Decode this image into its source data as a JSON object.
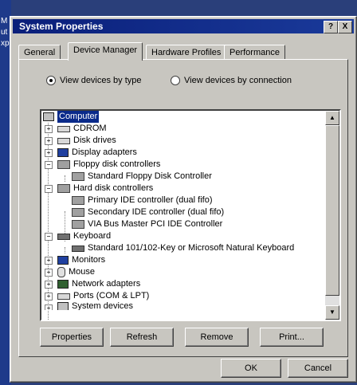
{
  "desktop": {
    "side_text": "M    ut    xp"
  },
  "window": {
    "title": "System Properties",
    "help_button": "?",
    "close_button": "X"
  },
  "tabs": [
    {
      "label": "General"
    },
    {
      "label": "Device Manager"
    },
    {
      "label": "Hardware Profiles"
    },
    {
      "label": "Performance"
    }
  ],
  "view_options": {
    "by_type": "View devices by type",
    "by_connection": "View devices by connection",
    "selected": "by_type"
  },
  "tree": {
    "root": "Computer",
    "items": [
      {
        "label": "CDROM",
        "expander": "+",
        "icon": "cdrom-icon"
      },
      {
        "label": "Disk drives",
        "expander": "+",
        "icon": "disk-drive-icon"
      },
      {
        "label": "Display adapters",
        "expander": "+",
        "icon": "display-adapter-icon"
      },
      {
        "label": "Floppy disk controllers",
        "expander": "−",
        "icon": "floppy-controller-icon"
      },
      {
        "label": "Standard Floppy Disk Controller",
        "icon": "floppy-controller-icon"
      },
      {
        "label": "Hard disk controllers",
        "expander": "−",
        "icon": "hard-disk-controller-icon"
      },
      {
        "label": "Primary IDE controller (dual fifo)",
        "icon": "ide-controller-icon"
      },
      {
        "label": "Secondary IDE controller (dual fifo)",
        "icon": "ide-controller-icon"
      },
      {
        "label": "VIA Bus Master PCI IDE Controller",
        "icon": "ide-controller-icon"
      },
      {
        "label": "Keyboard",
        "expander": "−",
        "icon": "keyboard-icon"
      },
      {
        "label": "Standard 101/102-Key or Microsoft Natural Keyboard",
        "icon": "keyboard-icon"
      },
      {
        "label": "Monitors",
        "expander": "+",
        "icon": "monitor-icon"
      },
      {
        "label": "Mouse",
        "expander": "+",
        "icon": "mouse-icon"
      },
      {
        "label": "Network adapters",
        "expander": "+",
        "icon": "network-adapter-icon"
      },
      {
        "label": "Ports (COM & LPT)",
        "expander": "+",
        "icon": "ports-icon"
      },
      {
        "label": "System devices",
        "expander": "+",
        "icon": "system-devices-icon"
      }
    ]
  },
  "buttons": {
    "properties": "Properties",
    "refresh": "Refresh",
    "remove": "Remove",
    "print": "Print...",
    "ok": "OK",
    "cancel": "Cancel"
  },
  "colors": {
    "title_bar": "#0a1f7a",
    "selection": "#0a2a8a",
    "face": "#c8c6c0"
  }
}
